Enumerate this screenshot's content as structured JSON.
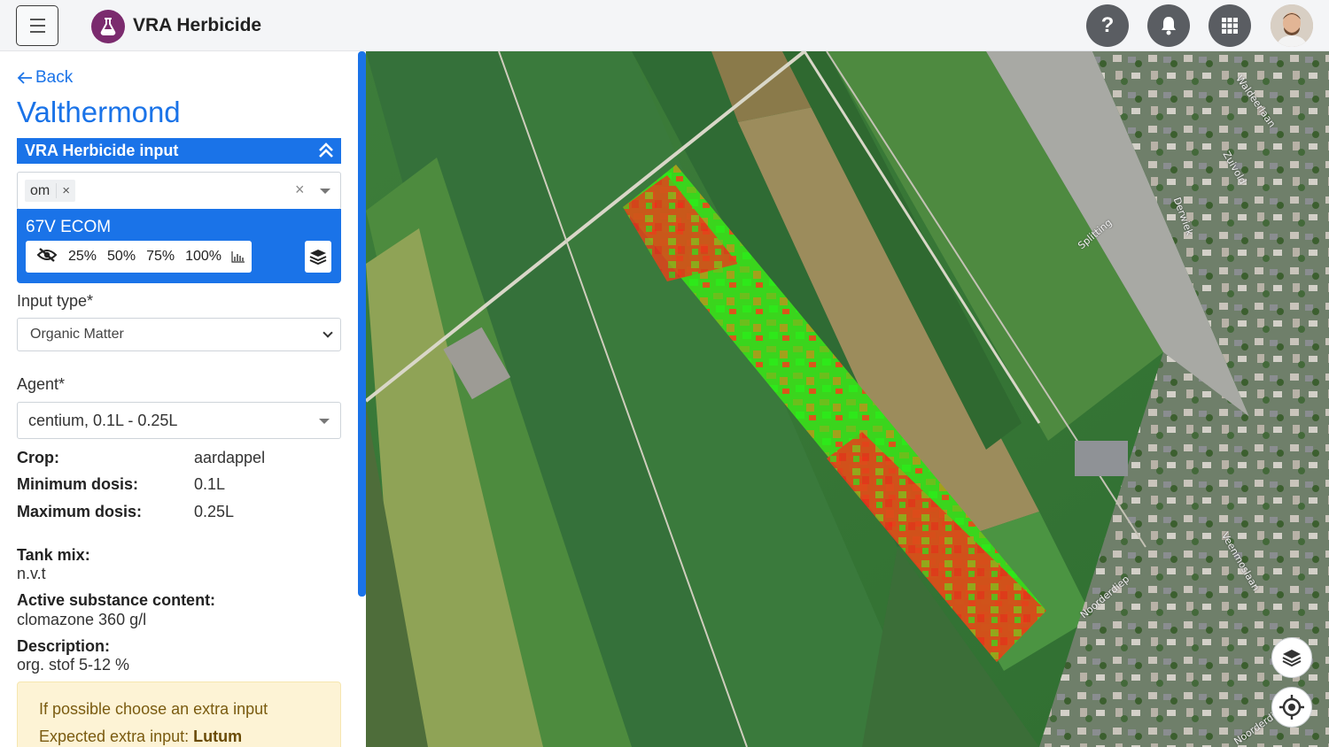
{
  "header": {
    "app_title": "VRA Herbicide",
    "help_label": "?"
  },
  "sidebar": {
    "back_label": "Back",
    "field_name": "Valthermond",
    "section_title": "VRA Herbicide input",
    "selected_tags": [
      {
        "label": "om",
        "remove": "×"
      }
    ],
    "clear_label": "×",
    "layer": {
      "name": "67V ECOM",
      "opacity_options": [
        "25%",
        "50%",
        "75%",
        "100%"
      ]
    },
    "input_type": {
      "label": "Input type*",
      "value": "Organic Matter"
    },
    "agent": {
      "label": "Agent*",
      "value": "centium, 0.1L - 0.25L"
    },
    "specs": [
      {
        "key": "Crop:",
        "value": "aardappel"
      },
      {
        "key": "Minimum dosis:",
        "value": "0.1L"
      },
      {
        "key": "Maximum dosis:",
        "value": "0.25L"
      }
    ],
    "details": [
      {
        "key": "Tank mix:",
        "value": "n.v.t"
      },
      {
        "key": "Active substance content:",
        "value": "clomazone 360 g/l"
      },
      {
        "key": "Description:",
        "value": "org. stof 5-12 %"
      }
    ],
    "alert": {
      "line1": "If possible choose an extra input",
      "line2_prefix": "Expected extra input: ",
      "line2_value": "Lutum"
    }
  },
  "map": {
    "street_labels": [
      "Splitting",
      "Derwiek",
      "Zuivold",
      "Waldeerlaan",
      "Noorderdiep",
      "Veenmoslaan",
      "Noorderdiep"
    ]
  },
  "colors": {
    "accent": "#1a73e8",
    "logo": "#7b2b6e",
    "alert_bg": "#fdf3d5",
    "alert_text": "#7a5b10",
    "vra_low": "#2ee81a",
    "vra_high": "#ef2a1a"
  },
  "icons": [
    "menu-icon",
    "flask-icon",
    "question-icon",
    "bell-icon",
    "grid-icon",
    "arrow-left-icon",
    "double-chevron-up-icon",
    "eye-slash-icon",
    "bar-chart-icon",
    "layers-icon",
    "crosshair-icon"
  ]
}
